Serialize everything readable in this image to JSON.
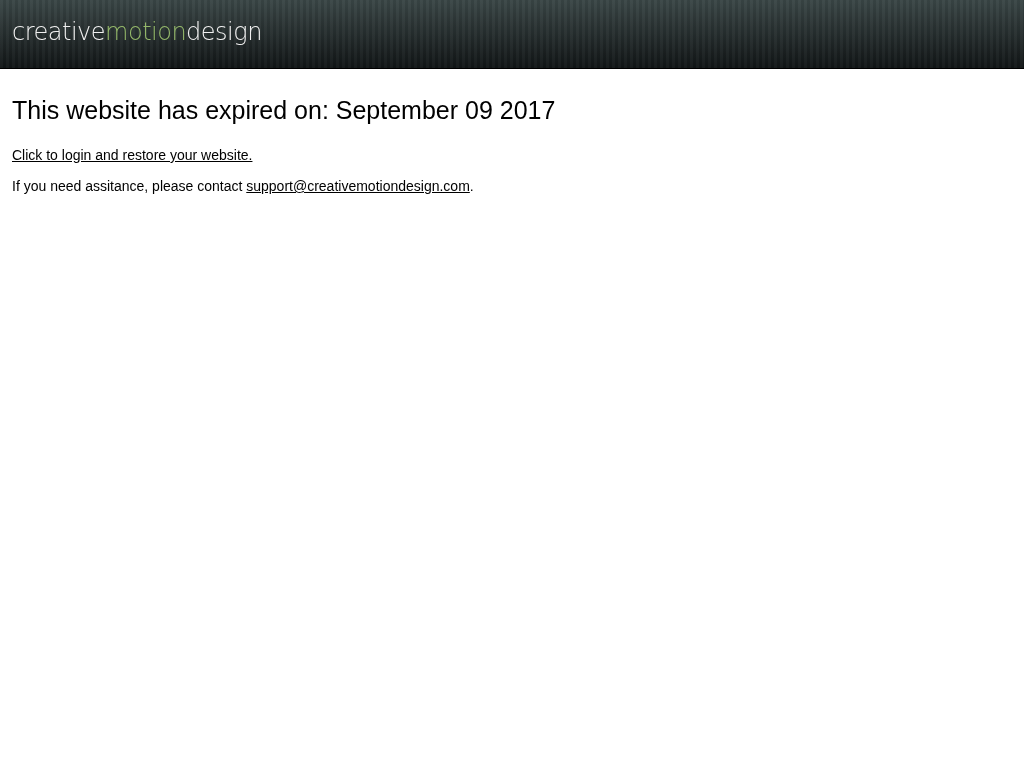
{
  "header": {
    "logo": [
      {
        "text": "creative",
        "accent": false
      },
      {
        "text": "motion",
        "accent": true
      },
      {
        "text": "design",
        "accent": false
      }
    ]
  },
  "heading": "This website has expired on: September 09 2017",
  "login_link": "Click to login and restore your website.",
  "contact": {
    "before": "If you need assitance, please contact",
    "link": "support@creativemotiondesign.com",
    "after": "."
  }
}
